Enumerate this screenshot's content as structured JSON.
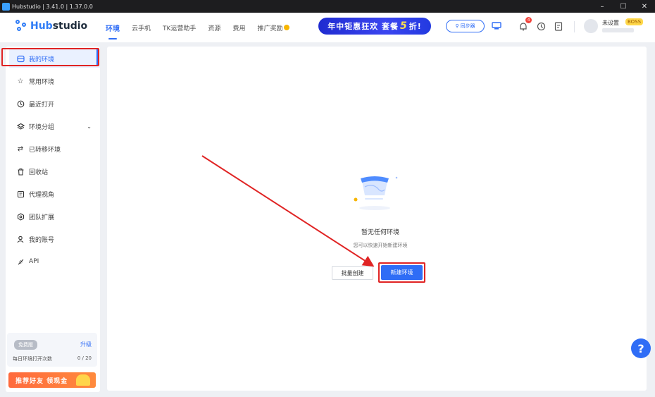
{
  "window": {
    "title": "Hubstudio | 3.41.0 | 1.37.0.0",
    "controls": [
      "–",
      "☐",
      "✕"
    ]
  },
  "brand": {
    "name_prefix": "",
    "name_hub": "Hub",
    "name_studio": "studio"
  },
  "nav": {
    "tabs": [
      {
        "label": "环境",
        "active": true
      },
      {
        "label": "云手机"
      },
      {
        "label": "TK运营助手"
      },
      {
        "label": "资源"
      },
      {
        "label": "费用"
      },
      {
        "label": "推广奖励"
      }
    ]
  },
  "promo": {
    "text_a": "年中钜惠狂欢",
    "text_b": "套餐",
    "text_big": "5",
    "text_c": "折!"
  },
  "sync_button": "同步器",
  "notifications": {
    "count": "4"
  },
  "user": {
    "name": "未设置",
    "tier": "BOSS"
  },
  "sidebar": {
    "items": [
      {
        "label": "我的环境",
        "icon": "monitor-icon",
        "active": true
      },
      {
        "label": "常用环境",
        "icon": "star-icon"
      },
      {
        "label": "最近打开",
        "icon": "clock-icon"
      },
      {
        "label": "环境分组",
        "icon": "layers-icon",
        "expandable": true
      },
      {
        "label": "已转移环境",
        "icon": "transfer-icon"
      },
      {
        "label": "回收站",
        "icon": "trash-icon"
      },
      {
        "label": "代理视角",
        "icon": "proxy-icon"
      },
      {
        "label": "团队扩展",
        "icon": "team-icon"
      },
      {
        "label": "我的账号",
        "icon": "user-icon"
      },
      {
        "label": "API",
        "icon": "api-icon"
      }
    ],
    "plan": {
      "badge": "免费版",
      "upgrade": "升级",
      "daily_label": "每日环境打开次数",
      "daily_count": "0 / 20"
    },
    "refer": "推荐好友 领现金"
  },
  "main": {
    "empty_title": "暂无任何环境",
    "empty_sub": "您可以快速开始新建环境",
    "batch_create": "批量创建",
    "new_env": "新建环境"
  },
  "help": "?"
}
